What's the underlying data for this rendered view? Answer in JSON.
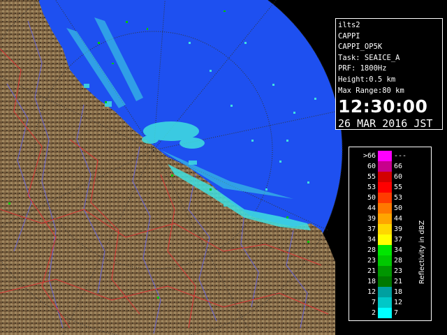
{
  "info": {
    "lines": [
      "ilts2",
      "CAPPI",
      "CAPPI_OP5K",
      "Task: SEAICE_A",
      "PRF: 1800Hz",
      "Height:0.5 km",
      "Max Range:80 km"
    ],
    "time": "12:30:00",
    "date": "26 MAR 2016 JST"
  },
  "legend": {
    "unit": "Reflectivity in dBZ",
    "rows": [
      {
        "lo": ">66",
        "hi": "---",
        "color": "#ff00ff"
      },
      {
        "lo": "60",
        "hi": "66",
        "color": "#c8008c"
      },
      {
        "lo": "55",
        "hi": "60",
        "color": "#d20000"
      },
      {
        "lo": "53",
        "hi": "55",
        "color": "#ff0000"
      },
      {
        "lo": "50",
        "hi": "53",
        "color": "#ff3c00"
      },
      {
        "lo": "44",
        "hi": "50",
        "color": "#ff7800"
      },
      {
        "lo": "39",
        "hi": "44",
        "color": "#ffa500"
      },
      {
        "lo": "37",
        "hi": "39",
        "color": "#ffd700"
      },
      {
        "lo": "34",
        "hi": "37",
        "color": "#ffff00"
      },
      {
        "lo": "28",
        "hi": "34",
        "color": "#00e600"
      },
      {
        "lo": "23",
        "hi": "28",
        "color": "#00c800"
      },
      {
        "lo": "21",
        "hi": "23",
        "color": "#009600"
      },
      {
        "lo": "18",
        "hi": "21",
        "color": "#007800"
      },
      {
        "lo": "12",
        "hi": "18",
        "color": "#00a0a0"
      },
      {
        "lo": "7",
        "hi": "12",
        "color": "#00c8c8"
      },
      {
        "lo": "2",
        "hi": "7",
        "color": "#00ffff"
      }
    ]
  },
  "colors": {
    "sea": "#1e50f0",
    "sea_outer": "#0000c8",
    "land": "#8a6e4a",
    "rivers": "#6464e6",
    "boundaries": "#dc3232",
    "echo_weak": "#40e0e0",
    "echo_mid": "#00c800"
  }
}
